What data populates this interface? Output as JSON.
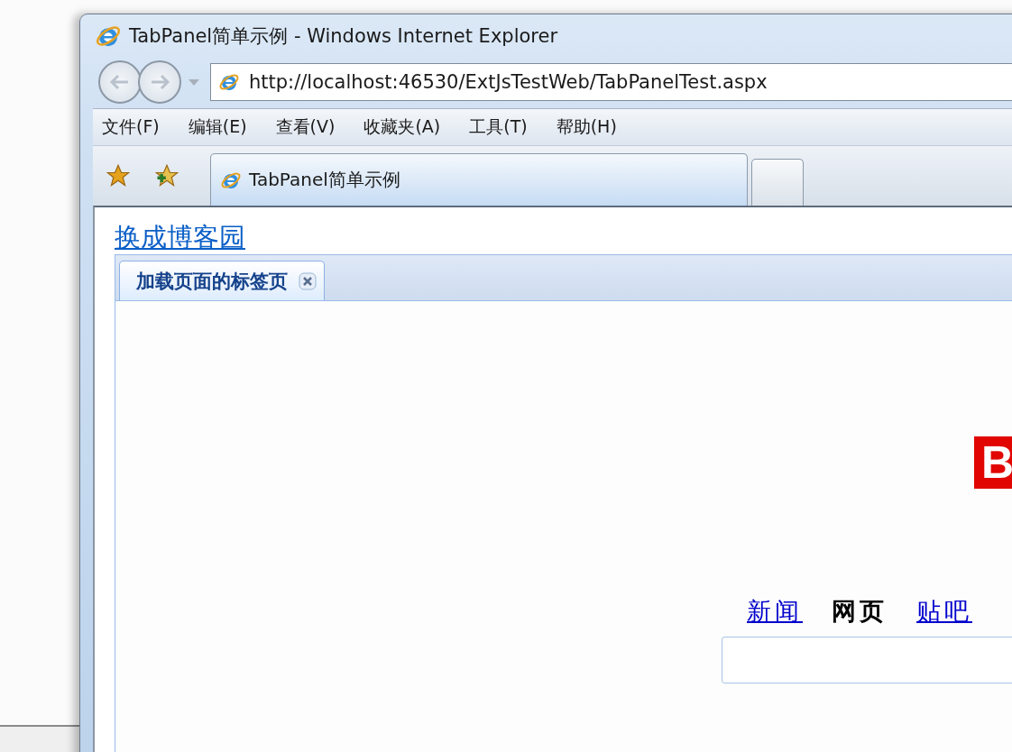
{
  "window": {
    "title": "TabPanel简单示例 - Windows Internet Explorer"
  },
  "address_bar": {
    "value": "http://localhost:46530/ExtJsTestWeb/TabPanelTest.aspx"
  },
  "menu": [
    "文件(F)",
    "编辑(E)",
    "查看(V)",
    "收藏夹(A)",
    "工具(T)",
    "帮助(H)"
  ],
  "browser_tabs": [
    {
      "label": "TabPanel简单示例",
      "selected": true
    }
  ],
  "page": {
    "link": "换成博客园",
    "tabs": [
      {
        "label": "加载页面的标签页",
        "selected": true,
        "closable": true
      }
    ],
    "frame": {
      "logo_text": "B",
      "nav": [
        {
          "label": "新闻",
          "selected": false
        },
        {
          "label": "网页",
          "selected": true
        },
        {
          "label": "贴吧",
          "selected": false
        }
      ]
    }
  }
}
